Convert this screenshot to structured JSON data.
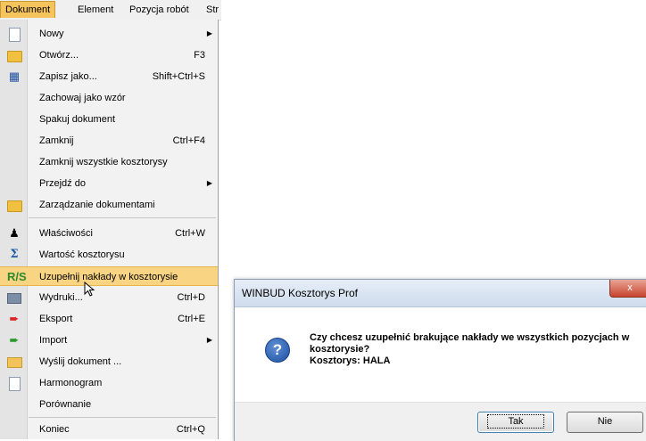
{
  "menubar": {
    "items": [
      {
        "label": "Dokument"
      },
      {
        "label": "Element"
      },
      {
        "label": "Pozycja robót"
      },
      {
        "label": "Str"
      }
    ]
  },
  "menu": {
    "items": [
      {
        "label": "Nowy",
        "shortcut": "",
        "icon": "new-document-icon",
        "submenu": true
      },
      {
        "label": "Otwórz...",
        "shortcut": "F3",
        "icon": "open-folder-icon"
      },
      {
        "label": "Zapisz jako...",
        "shortcut": "Shift+Ctrl+S",
        "icon": "save-as-icon"
      },
      {
        "label": "Zachowaj jako wzór",
        "shortcut": ""
      },
      {
        "label": "Spakuj dokument",
        "shortcut": ""
      },
      {
        "label": "Zamknij",
        "shortcut": "Ctrl+F4"
      },
      {
        "label": "Zamknij wszystkie kosztorysy",
        "shortcut": ""
      },
      {
        "label": "Przejdź do",
        "shortcut": "",
        "submenu": true
      },
      {
        "label": "Zarządzanie dokumentami",
        "shortcut": "",
        "icon": "folder-icon"
      },
      {
        "label": "Właściwości",
        "shortcut": "Ctrl+W",
        "icon": "properties-icon"
      },
      {
        "label": "Wartość kosztorysu",
        "shortcut": "",
        "icon": "sigma-icon"
      },
      {
        "label": "Uzupełnij nakłady w kosztorysie",
        "shortcut": "",
        "icon": "rms-fill-icon"
      },
      {
        "label": "Wydruki...",
        "shortcut": "Ctrl+D",
        "icon": "printer-icon"
      },
      {
        "label": "Eksport",
        "shortcut": "Ctrl+E",
        "icon": "export-icon"
      },
      {
        "label": "Import",
        "shortcut": "",
        "icon": "import-icon",
        "submenu": true
      },
      {
        "label": "Wyślij dokument ...",
        "shortcut": "",
        "icon": "mail-icon"
      },
      {
        "label": "Harmonogram",
        "shortcut": "",
        "icon": "schedule-icon"
      },
      {
        "label": "Porównanie",
        "shortcut": ""
      },
      {
        "label": "Koniec",
        "shortcut": "Ctrl+Q"
      }
    ]
  },
  "dialog": {
    "title": "WINBUD Kosztorys Prof",
    "close_glyph": "x",
    "question_glyph": "?",
    "message_line1": "Czy chcesz uzupełnić brakujące nakłady we wszystkich pozycjach w",
    "message_line2": "kosztorysie?",
    "message_line3": "Kosztorys: HALA",
    "yes_label": "Tak",
    "no_label": "Nie"
  },
  "colors": {
    "highlight": "#f8d483",
    "active_menu": "#f6c45c",
    "dialog_close": "#c7442f"
  }
}
